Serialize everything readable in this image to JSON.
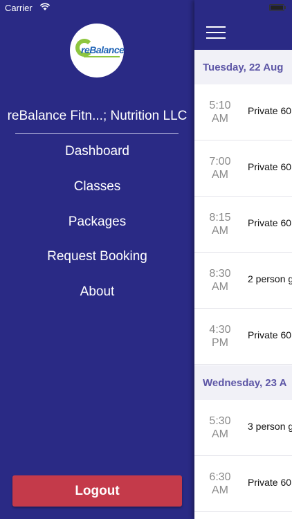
{
  "status_bar": {
    "carrier": "Carrier"
  },
  "menu": {
    "logo_text": "reBalance",
    "company_name": "reBalance Fitn...; Nutrition LLC",
    "items": [
      {
        "label": "Dashboard"
      },
      {
        "label": "Classes"
      },
      {
        "label": "Packages"
      },
      {
        "label": "Request Booking"
      },
      {
        "label": "About"
      }
    ],
    "logout_label": "Logout"
  },
  "schedule": {
    "days": [
      {
        "date": "Tuesday, 22 Aug",
        "sessions": [
          {
            "hour": "5:10",
            "ampm": "AM",
            "class": "Private 60"
          },
          {
            "hour": "7:00",
            "ampm": "AM",
            "class": "Private 60"
          },
          {
            "hour": "8:15",
            "ampm": "AM",
            "class": "Private 60"
          },
          {
            "hour": "8:30",
            "ampm": "AM",
            "class": "2 person g"
          },
          {
            "hour": "4:30",
            "ampm": "PM",
            "class": "Private 60"
          }
        ]
      },
      {
        "date": "Wednesday, 23 A",
        "sessions": [
          {
            "hour": "5:30",
            "ampm": "AM",
            "class": "3 person g"
          },
          {
            "hour": "6:30",
            "ampm": "AM",
            "class": "Private 60"
          }
        ]
      }
    ]
  },
  "colors": {
    "primary": "#2a2a85",
    "logout": "#c43a4a",
    "date_text": "#5d56a6",
    "logo_green": "#8ec63f",
    "logo_blue": "#1e63b5"
  }
}
